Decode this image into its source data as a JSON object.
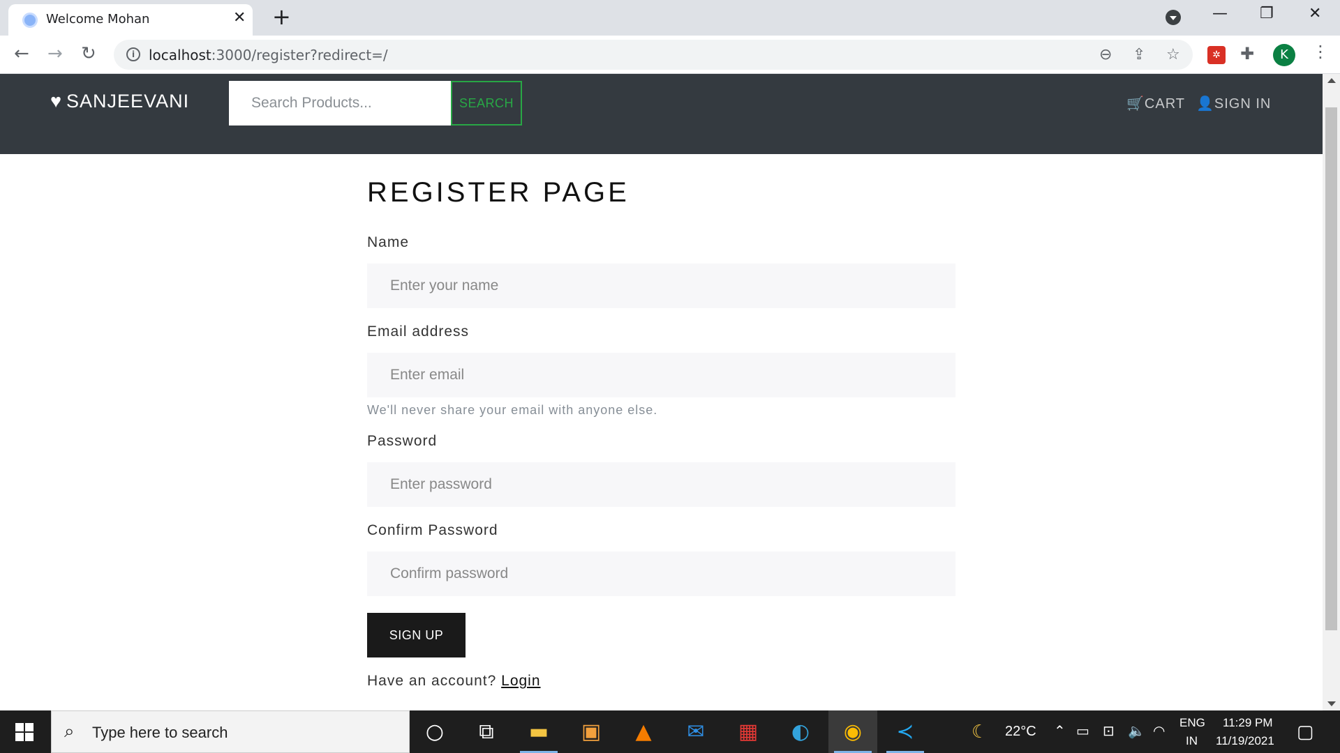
{
  "browser": {
    "tab_title": "Welcome Mohan",
    "tab_close": "✕",
    "new_tab": "+",
    "url_host": "localhost",
    "url_path": ":3000/register?redirect=/",
    "profile_initial": "K"
  },
  "navbar": {
    "brand": "SANJEEVANI",
    "search_placeholder": "Search Products...",
    "search_button": "SEARCH",
    "cart": "CART",
    "sign_in": "SIGN IN"
  },
  "form": {
    "title": "REGISTER PAGE",
    "name_label": "Name",
    "name_placeholder": "Enter your name",
    "email_label": "Email address",
    "email_placeholder": "Enter email",
    "email_help": "We'll never share your email with anyone else.",
    "password_label": "Password",
    "password_placeholder": "Enter password",
    "confirm_label": "Confirm Password",
    "confirm_placeholder": "Confirm password",
    "submit": "SIGN UP",
    "have_account": "Have an account?",
    "login_link": "Login"
  },
  "taskbar": {
    "search_placeholder": "Type here to search",
    "temperature": "22°C",
    "language": "ENG",
    "region": "IN",
    "time": "11:29 PM",
    "date": "11/19/2021"
  },
  "colors": {
    "navbar_bg": "#343a40",
    "search_accent": "#28a745",
    "button_bg": "#1a1a1a"
  }
}
